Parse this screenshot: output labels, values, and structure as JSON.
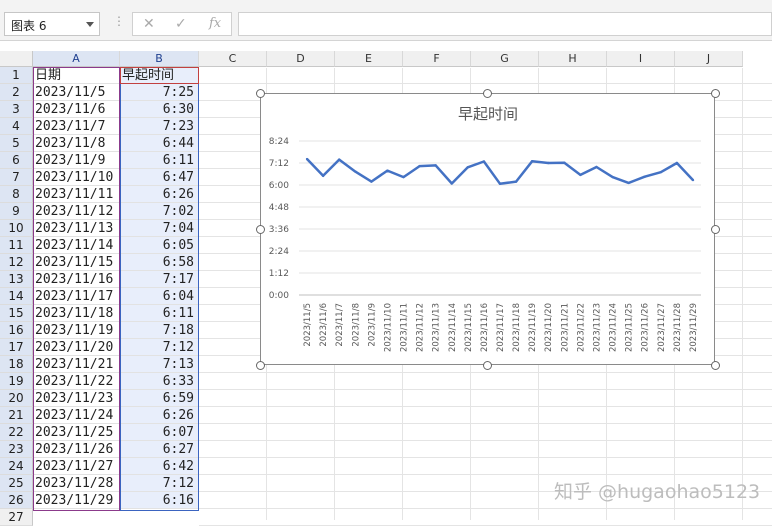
{
  "formula_bar": {
    "name_box": "图表 6",
    "cancel": "✕",
    "confirm": "✓",
    "fx": "fx",
    "formula": ""
  },
  "columns": [
    "A",
    "B",
    "C",
    "D",
    "E",
    "F",
    "G",
    "H",
    "I",
    "J"
  ],
  "header_row": {
    "a": "日期",
    "b": "早起时间"
  },
  "rows": [
    {
      "n": "1"
    },
    {
      "n": "2",
      "a": "2023/11/5",
      "b": "7:25"
    },
    {
      "n": "3",
      "a": "2023/11/6",
      "b": "6:30"
    },
    {
      "n": "4",
      "a": "2023/11/7",
      "b": "7:23"
    },
    {
      "n": "5",
      "a": "2023/11/8",
      "b": "6:44"
    },
    {
      "n": "6",
      "a": "2023/11/9",
      "b": "6:11"
    },
    {
      "n": "7",
      "a": "2023/11/10",
      "b": "6:47"
    },
    {
      "n": "8",
      "a": "2023/11/11",
      "b": "6:26"
    },
    {
      "n": "9",
      "a": "2023/11/12",
      "b": "7:02"
    },
    {
      "n": "10",
      "a": "2023/11/13",
      "b": "7:04"
    },
    {
      "n": "11",
      "a": "2023/11/14",
      "b": "6:05"
    },
    {
      "n": "12",
      "a": "2023/11/15",
      "b": "6:58"
    },
    {
      "n": "13",
      "a": "2023/11/16",
      "b": "7:17"
    },
    {
      "n": "14",
      "a": "2023/11/17",
      "b": "6:04"
    },
    {
      "n": "15",
      "a": "2023/11/18",
      "b": "6:11"
    },
    {
      "n": "16",
      "a": "2023/11/19",
      "b": "7:18"
    },
    {
      "n": "17",
      "a": "2023/11/20",
      "b": "7:12"
    },
    {
      "n": "18",
      "a": "2023/11/21",
      "b": "7:13"
    },
    {
      "n": "19",
      "a": "2023/11/22",
      "b": "6:33"
    },
    {
      "n": "20",
      "a": "2023/11/23",
      "b": "6:59"
    },
    {
      "n": "21",
      "a": "2023/11/24",
      "b": "6:26"
    },
    {
      "n": "22",
      "a": "2023/11/25",
      "b": "6:07"
    },
    {
      "n": "23",
      "a": "2023/11/26",
      "b": "6:27"
    },
    {
      "n": "24",
      "a": "2023/11/27",
      "b": "6:42"
    },
    {
      "n": "25",
      "a": "2023/11/28",
      "b": "7:12"
    },
    {
      "n": "26",
      "a": "2023/11/29",
      "b": "6:16"
    },
    {
      "n": "27"
    }
  ],
  "chart_data": {
    "type": "line",
    "title": "早起时间",
    "xlabel": "",
    "ylabel": "",
    "categories": [
      "2023/11/5",
      "2023/11/6",
      "2023/11/7",
      "2023/11/8",
      "2023/11/9",
      "2023/11/10",
      "2023/11/11",
      "2023/11/12",
      "2023/11/13",
      "2023/11/14",
      "2023/11/15",
      "2023/11/16",
      "2023/11/17",
      "2023/11/18",
      "2023/11/19",
      "2023/11/20",
      "2023/11/21",
      "2023/11/22",
      "2023/11/23",
      "2023/11/24",
      "2023/11/25",
      "2023/11/26",
      "2023/11/27",
      "2023/11/28",
      "2023/11/29"
    ],
    "values": [
      "7:25",
      "6:30",
      "7:23",
      "6:44",
      "6:11",
      "6:47",
      "6:26",
      "7:02",
      "7:04",
      "6:05",
      "6:58",
      "7:17",
      "6:04",
      "6:11",
      "7:18",
      "7:12",
      "7:13",
      "6:33",
      "6:59",
      "6:26",
      "6:07",
      "6:27",
      "6:42",
      "7:12",
      "6:16"
    ],
    "y_ticks": [
      "0:00",
      "1:12",
      "2:24",
      "3:36",
      "4:48",
      "6:00",
      "7:12",
      "8:24"
    ],
    "ylim": [
      "0:00",
      "8:24"
    ],
    "grid": true,
    "legend": "none",
    "line_color": "#4472c4"
  },
  "watermark": "知乎 @hugaohao5123"
}
